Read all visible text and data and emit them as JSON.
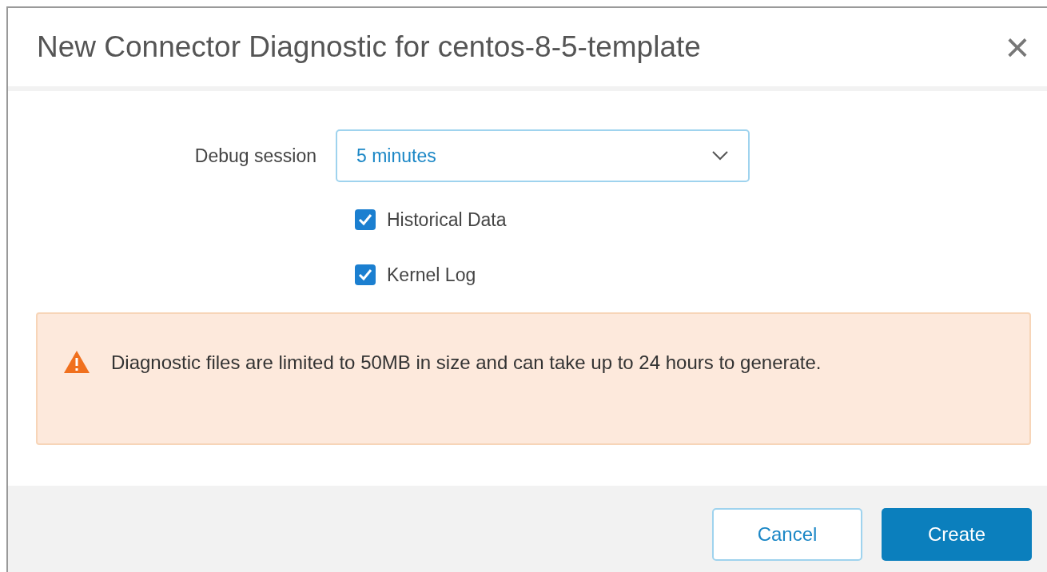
{
  "dialog": {
    "title": "New Connector Diagnostic for centos-8-5-template",
    "close": "×"
  },
  "debug_session": {
    "label": "Debug session",
    "value": "5 minutes"
  },
  "options": [
    {
      "label": "Historical Data",
      "checked": true
    },
    {
      "label": "Kernel Log",
      "checked": true
    }
  ],
  "warning": {
    "text": "Diagnostic files are limited to 50MB in size and can take up to 24 hours to generate."
  },
  "buttons": [
    {
      "label": "Cancel",
      "kind": "secondary"
    },
    {
      "label": "Create",
      "kind": "primary"
    }
  ]
}
